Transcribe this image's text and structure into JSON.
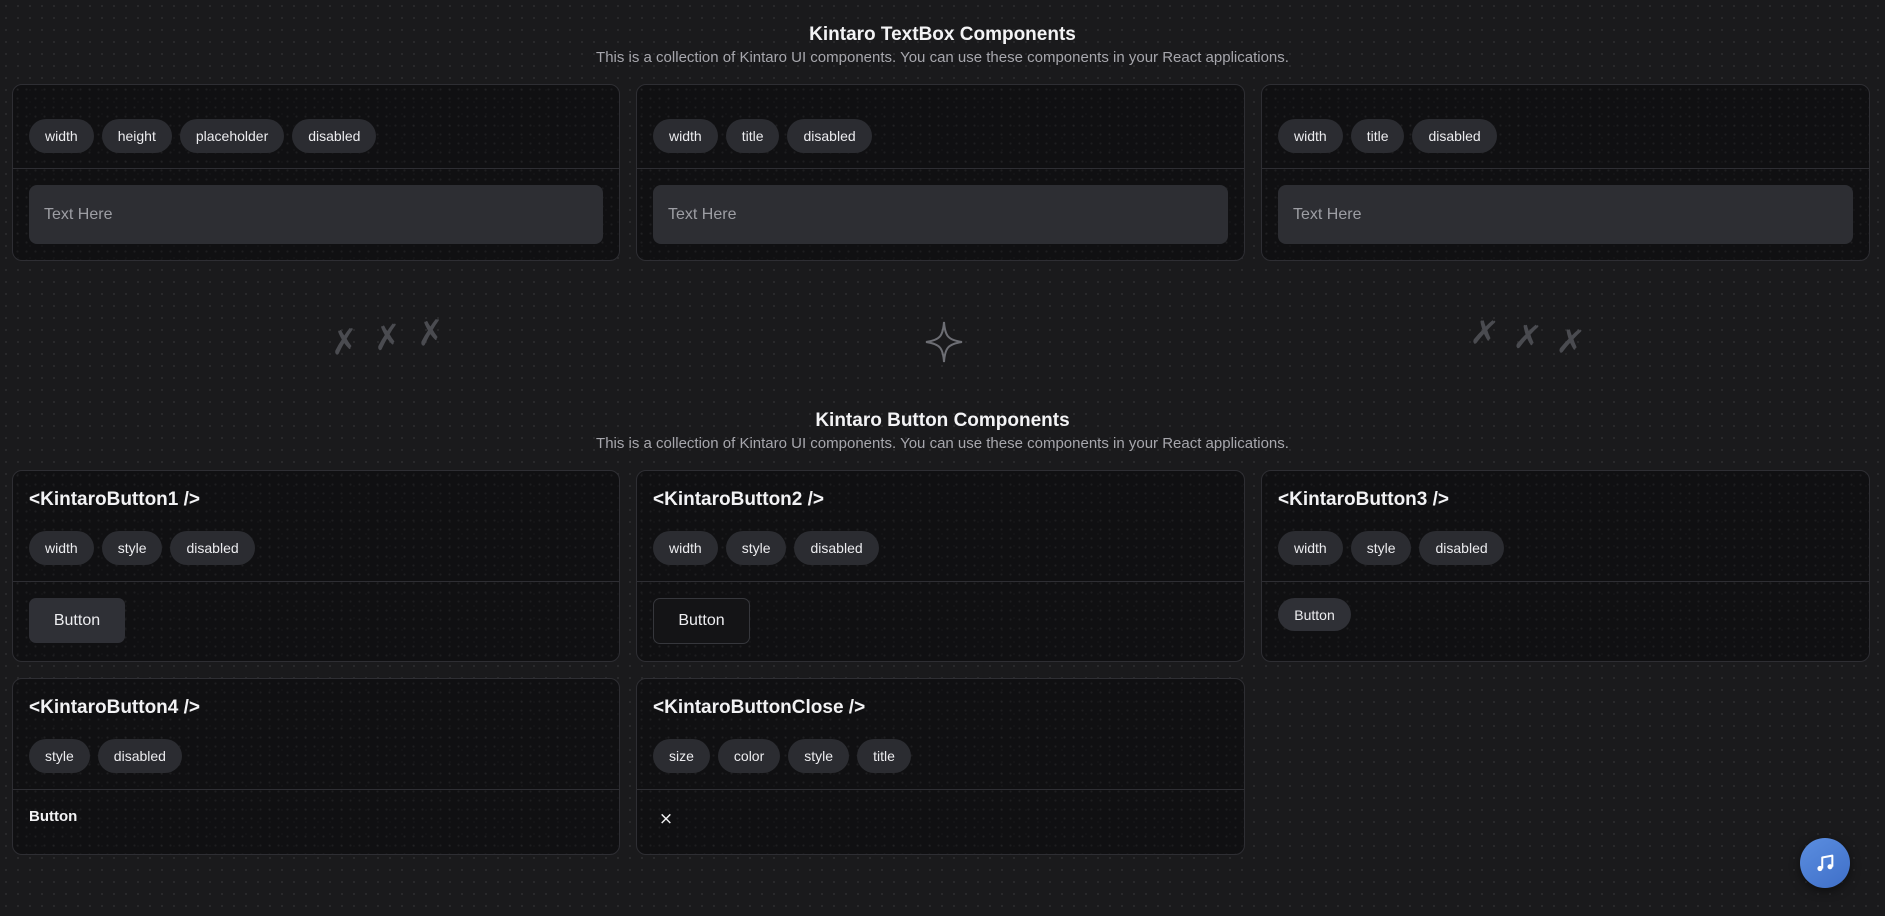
{
  "textbox_section": {
    "title": "Kintaro TextBox Components",
    "subtitle": "This is a collection of Kintaro UI components. You can use these components in your React applications.",
    "cards": [
      {
        "props": [
          "width",
          "height",
          "placeholder",
          "disabled"
        ],
        "placeholder": "Text Here"
      },
      {
        "props": [
          "width",
          "title",
          "disabled"
        ],
        "placeholder": "Text Here"
      },
      {
        "props": [
          "width",
          "title",
          "disabled"
        ],
        "placeholder": "Text Here"
      }
    ]
  },
  "divider": {
    "left_marks": "✗ ✗ ✗",
    "right_marks": "✗ ✗ ✗",
    "center_icon": "sparkle-star-icon"
  },
  "button_section": {
    "title": "Kintaro Button Components",
    "subtitle": "This is a collection of Kintaro UI components. You can use these components in your React applications.",
    "cards": [
      {
        "name": "<KintaroButton1 />",
        "props": [
          "width",
          "style",
          "disabled"
        ],
        "button_label": "Button"
      },
      {
        "name": "<KintaroButton2 />",
        "props": [
          "width",
          "style",
          "disabled"
        ],
        "button_label": "Button"
      },
      {
        "name": "<KintaroButton3 />",
        "props": [
          "width",
          "style",
          "disabled"
        ],
        "button_label": "Button"
      },
      {
        "name": "<KintaroButton4 />",
        "props": [
          "style",
          "disabled"
        ],
        "button_label": "Button"
      },
      {
        "name": "<KintaroButtonClose />",
        "props": [
          "size",
          "color",
          "style",
          "title"
        ],
        "button_label": "×"
      }
    ]
  },
  "music_button": {
    "icon": "music-note-icon"
  },
  "colors": {
    "background": "#1a1a1c",
    "chip": "#2b2c31",
    "textbox": "#2d2e33",
    "accent": "#4f7fd6"
  }
}
